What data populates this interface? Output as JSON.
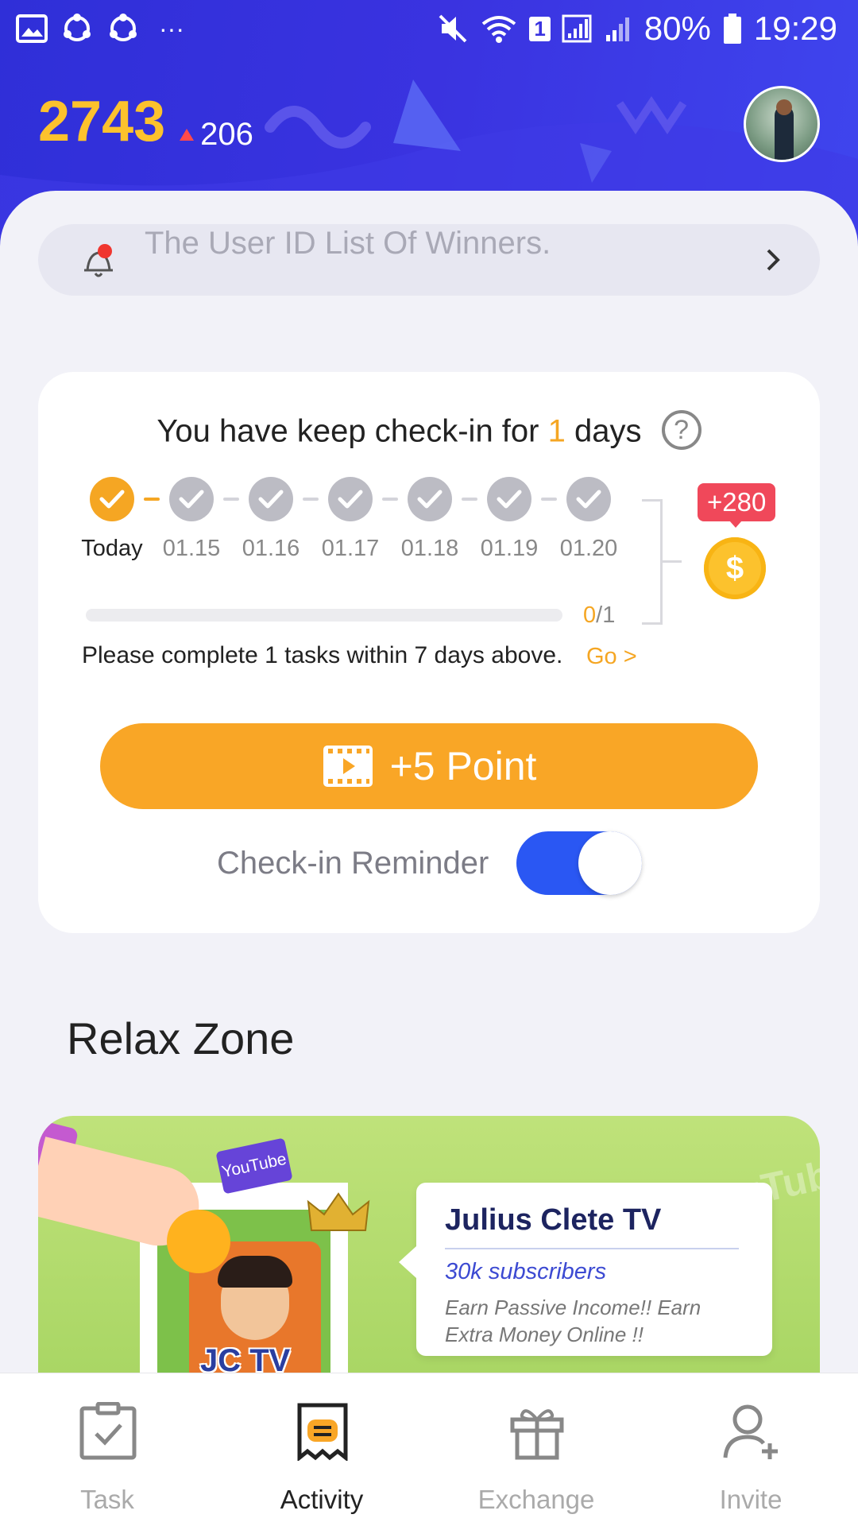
{
  "status_bar": {
    "battery": "80%",
    "time": "19:29",
    "sim": "1",
    "more": "···"
  },
  "header": {
    "points": "2743",
    "delta": "206"
  },
  "notice": {
    "text": "The User ID List Of Winners."
  },
  "checkin": {
    "title_prefix": "You have keep check-in for ",
    "days": "1",
    "title_suffix": " days",
    "help": "?",
    "steps": [
      {
        "label": "Today",
        "state": "today"
      },
      {
        "label": "01.15",
        "state": "done"
      },
      {
        "label": "01.16",
        "state": "done"
      },
      {
        "label": "01.17",
        "state": "done"
      },
      {
        "label": "01.18",
        "state": "done"
      },
      {
        "label": "01.19",
        "state": "done"
      },
      {
        "label": "01.20",
        "state": "done"
      }
    ],
    "bonus": "+280",
    "coin_symbol": "$",
    "progress_current": "0",
    "progress_total": "/1",
    "progress_fraction": 0,
    "task_note": "Please complete 1 tasks within 7 days above.",
    "go_label": "Go >",
    "point_button": "+5 Point",
    "reminder_label": "Check-in Reminder",
    "reminder_on": true
  },
  "relax": {
    "title": "Relax Zone",
    "banner": {
      "youtube_chip": "YouTube",
      "logo_text": "JC TV",
      "channel_name": "Julius Clete TV",
      "subscribers": "30k subscribers",
      "description": "Earn Passive Income!! Earn Extra Money Online !!"
    }
  },
  "nav": {
    "items": [
      {
        "label": "Task",
        "icon": "task-icon"
      },
      {
        "label": "Activity",
        "icon": "activity-icon",
        "active": true
      },
      {
        "label": "Exchange",
        "icon": "gift-icon"
      },
      {
        "label": "Invite",
        "icon": "invite-icon"
      }
    ]
  },
  "colors": {
    "header_blue": "#3a33e0",
    "accent_orange": "#f9a626",
    "score_yellow": "#fcc22d",
    "toggle_blue": "#2a57f3",
    "badge_red": "#f0485a"
  }
}
